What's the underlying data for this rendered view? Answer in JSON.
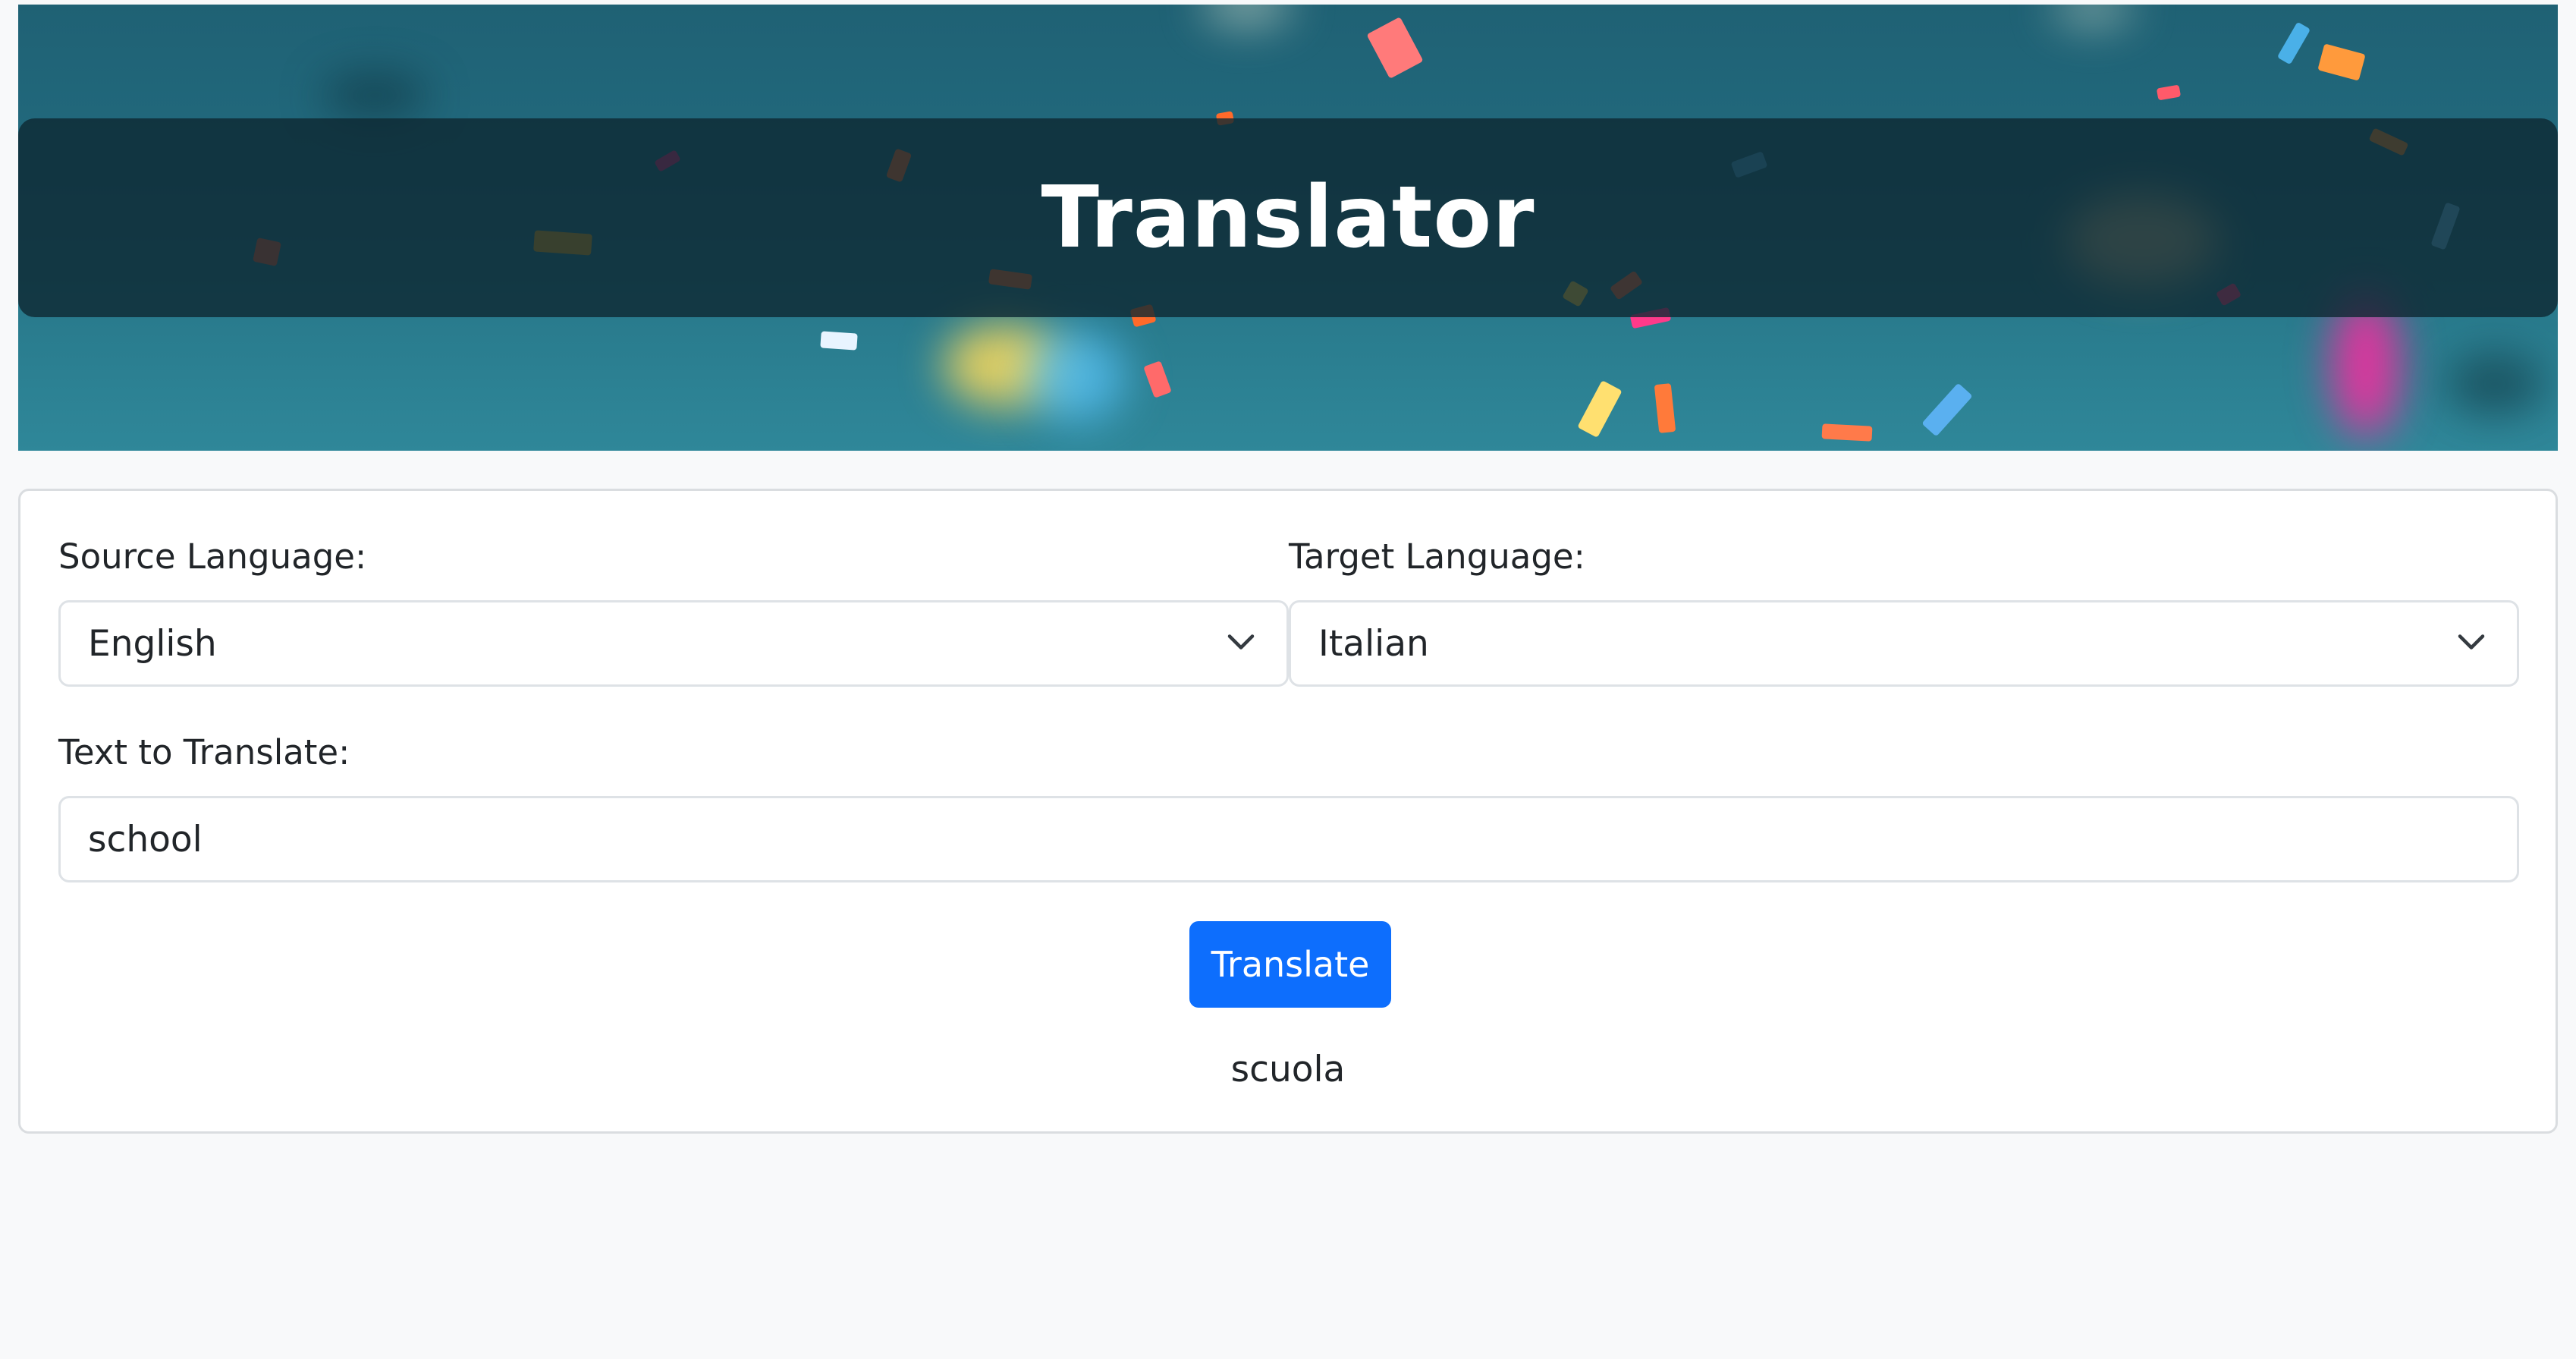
{
  "header": {
    "title": "Translator"
  },
  "form": {
    "source_label": "Source Language:",
    "source_value": "English",
    "target_label": "Target Language:",
    "target_value": "Italian",
    "text_label": "Text to Translate:",
    "text_value": "school",
    "translate_button": "Translate",
    "result": "scuola"
  },
  "icons": {
    "dropdown": "chevron-down-icon"
  },
  "colors": {
    "primary": "#0d6efd",
    "page_bg": "#f8f9fa",
    "hero_bg": "#226b7f",
    "hero_band": "#0e2832"
  }
}
